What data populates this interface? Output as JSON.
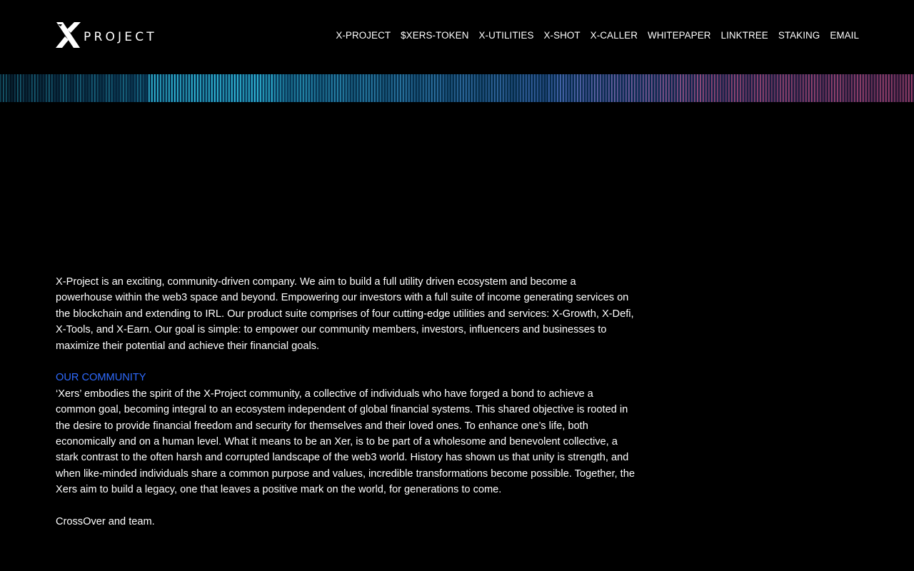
{
  "header": {
    "logo": {
      "icon": "x-logo-icon",
      "text": "PROJECT"
    },
    "nav": [
      {
        "label": "X-PROJECT"
      },
      {
        "label": "$XERS-TOKEN"
      },
      {
        "label": "X-UTILITIES"
      },
      {
        "label": "X-SHOT"
      },
      {
        "label": "X-CALLER"
      },
      {
        "label": "WHITEPAPER"
      },
      {
        "label": "LINKTREE"
      },
      {
        "label": "STAKING"
      },
      {
        "label": "EMAIL"
      }
    ]
  },
  "colors": {
    "background": "#000000",
    "text": "#ffffff",
    "accent": "#2f6bff",
    "banner_cyan": "#39d6f5",
    "banner_pink": "#d65a8c"
  },
  "main": {
    "intro": "X-Project is an exciting, community-driven company. We aim to build a full utility driven ecosystem and become a powerhouse within the web3 space and beyond. Empowering our investors with a full suite of income generating services on the blockchain and extending to IRL. Our product suite comprises of four cutting-edge utilities and services: X-Growth, X-Defi, X-Tools, and X-Earn. Our goal is simple: to empower our community members, investors, influencers and businesses to maximize their potential and achieve their financial goals.",
    "community_heading": "OUR COMMUNITY",
    "community_text": "‘Xers’ embodies the spirit of the X-Project community, a collective of individuals who have forged a bond to achieve a common goal, becoming integral to an ecosystem independent of global financial systems. This shared objective is rooted in the desire to provide financial freedom and security for themselves and their loved ones. To enhance one’s life, both economically and on a human level. What it means to be an Xer, is to be part of a wholesome and benevolent collective, a stark contrast to the often harsh and corrupted landscape of the web3 world. History has shown us that unity is strength, and when like-minded individuals share a common purpose and values, incredible transformations become possible. Together, the Xers aim to build a legacy, one that leaves a positive mark on the world, for generations to come.",
    "signoff": "CrossOver and team."
  }
}
